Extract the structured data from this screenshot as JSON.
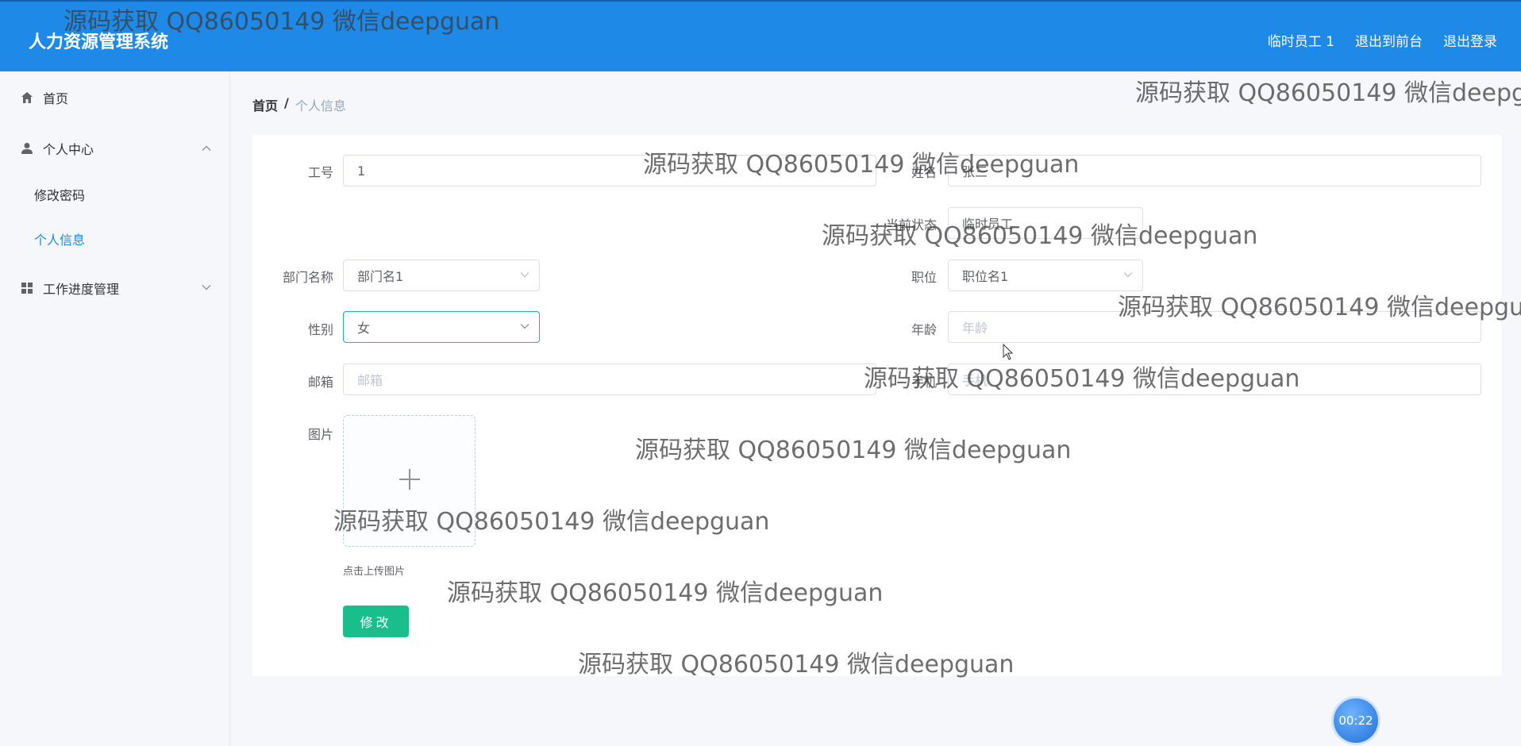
{
  "header": {
    "title": "人力资源管理系统",
    "user": "临时员工 1",
    "to_front": "退出到前台",
    "logout": "退出登录"
  },
  "sidebar": {
    "home": "首页",
    "personal_center": "个人中心",
    "change_password": "修改密码",
    "personal_info": "个人信息",
    "work_progress": "工作进度管理"
  },
  "breadcrumb": {
    "home": "首页",
    "separator": "/",
    "current": "个人信息"
  },
  "form": {
    "emp_no_label": "工号",
    "emp_no_value": "1",
    "name_label": "姓名",
    "name_value": "张三",
    "status_label": "当前状态",
    "status_value": "临时员工",
    "dept_label": "部门名称",
    "dept_value": "部门名1",
    "position_label": "职位",
    "position_value": "职位名1",
    "gender_label": "性别",
    "gender_value": "女",
    "age_label": "年龄",
    "age_placeholder": "年龄",
    "email_label": "邮箱",
    "email_placeholder": "邮箱",
    "phone_label": "手机",
    "phone_placeholder": "手机",
    "photo_label": "图片",
    "upload_tip": "点击上传图片",
    "submit": "修改"
  },
  "watermark_text": "源码获取 QQ86050149 微信deepguan",
  "timer": "00:22",
  "colors": {
    "header_bg": "#1f89e8",
    "primary_green": "#19be8b",
    "active_menu": "#1f89e8"
  }
}
